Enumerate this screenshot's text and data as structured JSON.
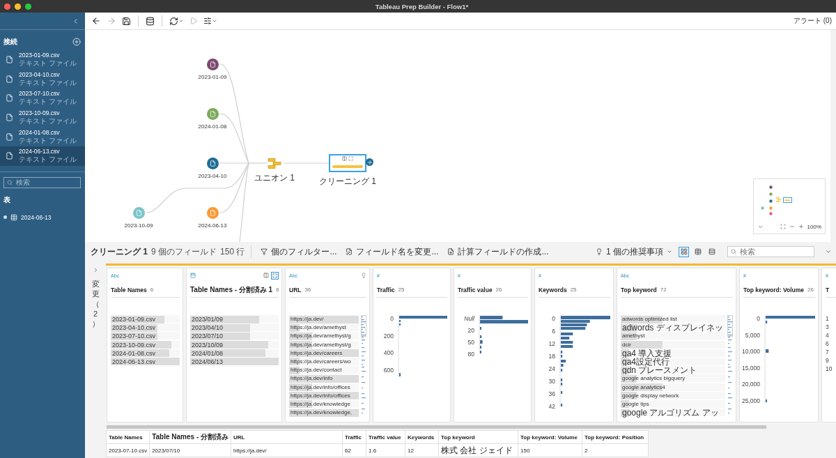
{
  "window": {
    "title": "Tableau Prep Builder - Flow1*"
  },
  "toolbar": {
    "buttons": [
      {
        "kind": "back",
        "disabled": false
      },
      {
        "kind": "forward",
        "disabled": true
      },
      {
        "kind": "save",
        "disabled": false
      },
      {
        "kind": "data",
        "disabled": false
      },
      {
        "kind": "refresh",
        "disabled": false
      },
      {
        "kind": "run",
        "disabled": true
      },
      {
        "kind": "options",
        "disabled": false
      }
    ],
    "alerts": "アラート (0)"
  },
  "sidebar": {
    "connections_title": "接続",
    "connections": [
      {
        "name": "2023-01-09.csv",
        "type": "テキスト ファイル",
        "selected": false
      },
      {
        "name": "2023-04-10.csv",
        "type": "テキスト ファイル",
        "selected": false
      },
      {
        "name": "2023-07-10.csv",
        "type": "テキスト ファイル",
        "selected": false
      },
      {
        "name": "2023-10-09.csv",
        "type": "テキスト ファイル",
        "selected": false
      },
      {
        "name": "2024-01-08.csv",
        "type": "テキスト ファイル",
        "selected": false
      },
      {
        "name": "2024-06-13.csv",
        "type": "テキスト ファイル",
        "selected": true
      }
    ],
    "search": {
      "placeholder": "検索"
    },
    "tables_title": "表",
    "tables": [
      {
        "name": "2024-06-13"
      }
    ]
  },
  "flow": {
    "nodes": [
      {
        "kind": "input",
        "label": "2023-01-09",
        "color": "#7e4a6f",
        "selected": false
      },
      {
        "kind": "input",
        "label": "2024-01-08",
        "color": "#7dab5b",
        "selected": false
      },
      {
        "kind": "input",
        "label": "2023-04-10",
        "color": "#226e95",
        "selected": false
      },
      {
        "kind": "input",
        "label": "2023-10-09",
        "color": "#7cc5c9",
        "selected": false
      },
      {
        "kind": "input",
        "label": "2024-06-13",
        "color": "#fb9a38",
        "selected": false
      },
      {
        "kind": "union",
        "label": "ユニオン 1",
        "selected": false
      },
      {
        "kind": "clean",
        "label": "クリーニング 1",
        "selected": true
      }
    ],
    "zoom": "100%"
  },
  "profile": {
    "title": "クリーニング 1",
    "fields": "9 個のフィールド",
    "rows": "150 行",
    "actions": [
      {
        "kind": "filter",
        "label": "個のフィルター..."
      },
      {
        "kind": "rename",
        "label": "フィールド名を変更..."
      },
      {
        "kind": "calc",
        "label": "計算フィールドの作成..."
      }
    ],
    "recommendations": "1 個の推奨事項",
    "views": [
      {
        "kind": "cards",
        "selected": true
      },
      {
        "kind": "table",
        "selected": false
      },
      {
        "kind": "list",
        "selected": false
      }
    ],
    "search": {
      "placeholder": "検索"
    },
    "changes": "変更（2）",
    "cards": [
      {
        "kind": "values",
        "type_label": "Abc",
        "name": "Table Names",
        "count": "6",
        "values": [
          {
            "text": "2023-01-09.csv",
            "level": 0.78
          },
          {
            "text": "2023-04-10.csv",
            "level": 0.68
          },
          {
            "text": "2023-07-10.csv",
            "level": 0.68
          },
          {
            "text": "2023-10-09.csv",
            "level": 0.88
          },
          {
            "text": "2024-01-08.csv",
            "level": 0.85
          },
          {
            "text": "2024-06-13.csv",
            "level": 1
          }
        ]
      },
      {
        "kind": "values",
        "name": "Table Names - 分割済み 1",
        "count": "6",
        "values": [
          {
            "text": "2023/01/09",
            "level": 0.78
          },
          {
            "text": "2023/04/10",
            "level": 0.68
          },
          {
            "text": "2023/07/10",
            "level": 0.68
          },
          {
            "text": "2023/10/09",
            "level": 0.88
          },
          {
            "text": "2024/01/08",
            "level": 0.85
          },
          {
            "text": "2024/06/13",
            "level": 1
          }
        ]
      },
      {
        "kind": "values",
        "type_label": "Abc",
        "name": "URL",
        "count": "36",
        "values": [
          {
            "text": "https://ja.dev/",
            "level": 1
          },
          {
            "text": "https://ja.dev/amethyst",
            "level": 0.15
          },
          {
            "text": "https://ja.dev/amethyst/g",
            "level": 0.33
          },
          {
            "text": "https://ja.dev/amethyst/g",
            "level": 0.33
          },
          {
            "text": "https://ja.dev/careers",
            "level": 1
          },
          {
            "text": "https://ja.dev/careers/wo",
            "level": 0.15
          },
          {
            "text": "https://ja.dev/contact",
            "level": 0.15
          },
          {
            "text": "https://ja.dev/info",
            "level": 1
          },
          {
            "text": "https://ja.dev/info/offices",
            "level": 0.33
          },
          {
            "text": "https://ja.dev/info/offices",
            "level": 1
          },
          {
            "text": "https://ja.dev/knowledge",
            "level": 0.33
          },
          {
            "text": "https://ja.dev/knowledge,",
            "level": 1
          }
        ]
      },
      {
        "kind": "histogram",
        "type_label": "#",
        "name": "Traffic",
        "count": "25",
        "ticks": [
          "0",
          "200",
          "400",
          "600"
        ]
      },
      {
        "kind": "histogram",
        "type_label": "#",
        "name": "Traffic value",
        "count": "26",
        "null_label": "Null",
        "ticks": [
          "20",
          "50",
          "80"
        ]
      },
      {
        "kind": "histogram",
        "type_label": "#",
        "name": "Keywords",
        "count": "25",
        "ticks": [
          "0",
          "6",
          "12",
          "18",
          "24",
          "30",
          "36",
          "42"
        ]
      },
      {
        "kind": "values",
        "type_label": "Abc",
        "name": "Top keyword",
        "count": "72",
        "values": [
          {
            "text": "adwords optimized list",
            "level": 0.4
          },
          {
            "text": "adwords ディスプレイネッ",
            "level": 0.15
          },
          {
            "text": "amethyst",
            "level": 0.15
          },
          {
            "text": "dcir",
            "level": 0.4
          },
          {
            "text": "ga4 導入支援",
            "level": 0.08
          },
          {
            "text": "ga4設定代行",
            "level": 0.08
          },
          {
            "text": "gdn プレースメント",
            "level": 0.08
          },
          {
            "text": "google analytics bigquery",
            "level": 0.15
          },
          {
            "text": "google analytics4",
            "level": 0.4
          },
          {
            "text": "google display network",
            "level": 0.15
          },
          {
            "text": "google tips",
            "level": 0.08
          },
          {
            "text": "google アルゴリズム アッ",
            "level": 0.08
          }
        ]
      },
      {
        "kind": "histogram",
        "type_label": "#",
        "name": "Top keyword: Volume",
        "count": "26",
        "ticks": [
          "0",
          "5,000",
          "10,000",
          "15,000",
          "20,000",
          "25,000"
        ]
      },
      {
        "kind": "histogram",
        "type_label": "#",
        "name": "T",
        "ticks": [
          "1",
          "3",
          "4",
          "6",
          "7",
          "9",
          "10"
        ]
      }
    ]
  },
  "grid": {
    "columns": [
      "Table Names",
      "Table Names - 分割済み",
      "URL",
      "Traffic",
      "Traffic value",
      "Keywords",
      "Top keyword",
      "Top keyword: Volume",
      "Top keyword: Position"
    ],
    "rows": [
      [
        "2023-07-10.csv",
        "2023/07/10",
        "https://ja.dev/",
        "62",
        "1.6",
        "12",
        "株式 会社 ジェイド",
        "150",
        "2"
      ]
    ]
  }
}
